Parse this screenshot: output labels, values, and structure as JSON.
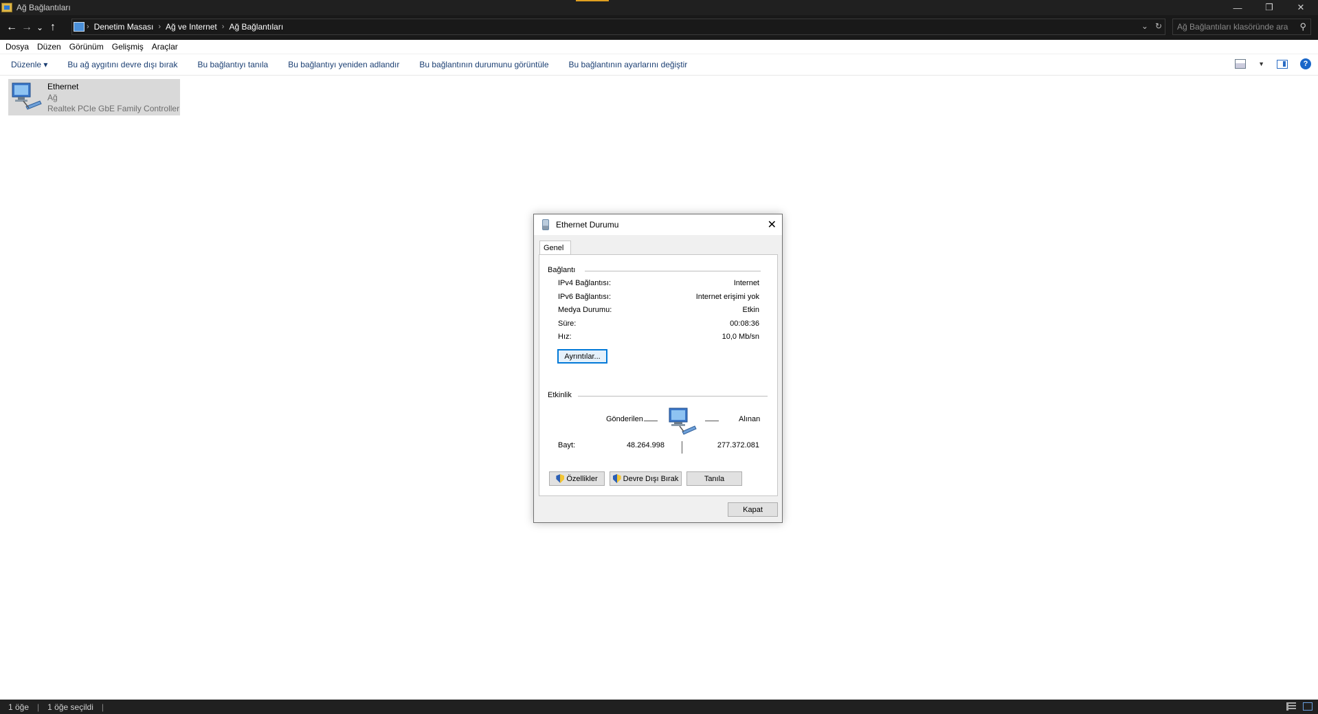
{
  "window": {
    "title": "Ağ Bağlantıları",
    "controls": {
      "minimize": "—",
      "restore": "❐",
      "close": "✕"
    }
  },
  "nav": {
    "back": "←",
    "forward": "→",
    "recent": "⌄",
    "up": "↑"
  },
  "address": {
    "breadcrumbs": [
      "Denetim Masası",
      "Ağ ve Internet",
      "Ağ Bağlantıları"
    ],
    "search_placeholder": "Ağ Bağlantıları klasöründe ara"
  },
  "menu": [
    "Dosya",
    "Düzen",
    "Görünüm",
    "Gelişmiş",
    "Araçlar"
  ],
  "commands": {
    "organize": "Düzenle ▾",
    "disable": "Bu ağ aygıtını devre dışı bırak",
    "diagnose": "Bu bağlantıyı tanıla",
    "rename": "Bu bağlantıyı yeniden adlandır",
    "status": "Bu bağlantının durumunu görüntüle",
    "settings": "Bu bağlantının ayarlarını değiştir"
  },
  "connection": {
    "name": "Ethernet",
    "network": "Ağ",
    "adapter": "Realtek PCIe GbE Family Controller"
  },
  "dialog": {
    "title": "Ethernet Durumu",
    "tab": "Genel",
    "connection_group": "Bağlantı",
    "rows": [
      {
        "label": "IPv4 Bağlantısı:",
        "value": "Internet"
      },
      {
        "label": "IPv6 Bağlantısı:",
        "value": "Internet erişimi yok"
      },
      {
        "label": "Medya Durumu:",
        "value": "Etkin"
      },
      {
        "label": "Süre:",
        "value": "00:08:36"
      },
      {
        "label": "Hız:",
        "value": "10,0 Mb/sn"
      }
    ],
    "details_button": "Ayrıntılar...",
    "activity_group": "Etkinlik",
    "sent_label": "Gönderilen",
    "received_label": "Alınan",
    "bytes_label": "Bayt:",
    "bytes_sent": "48.264.998",
    "bytes_received": "277.372.081",
    "properties_button": "Özellikler",
    "disable_button": "Devre Dışı Bırak",
    "diagnose_button": "Tanıla",
    "close_button": "Kapat"
  },
  "status": {
    "count": "1 öğe",
    "selected": "1 öğe seçildi"
  }
}
